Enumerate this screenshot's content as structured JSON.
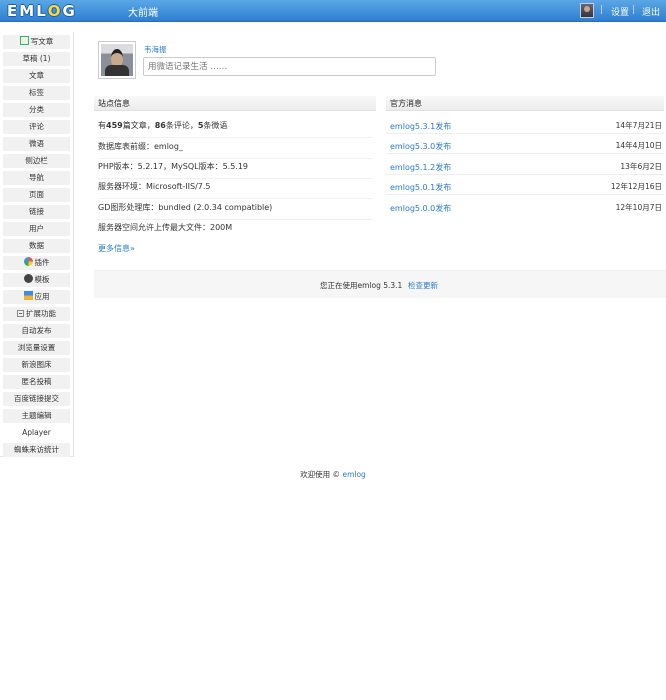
{
  "header": {
    "logo_letters": [
      "E",
      "M",
      "L",
      "O",
      "G"
    ],
    "site_link": "大前端",
    "settings_label": "设置",
    "logout_label": "退出",
    "separator": "|"
  },
  "sidebar": {
    "items": [
      {
        "label": "写文章",
        "icon": "pencil-icon"
      },
      {
        "label": "草稿 (1)"
      },
      {
        "label": "文章"
      },
      {
        "label": "标签"
      },
      {
        "label": "分类"
      },
      {
        "label": "评论"
      },
      {
        "label": "微语"
      },
      {
        "label": "侧边栏"
      },
      {
        "label": "导航"
      },
      {
        "label": "页面"
      },
      {
        "label": "链接"
      },
      {
        "label": "用户"
      },
      {
        "label": "数据"
      },
      {
        "label": "插件",
        "icon": "plugin-icon"
      },
      {
        "label": "模板",
        "icon": "gear-icon"
      },
      {
        "label": "应用",
        "icon": "app-icon"
      },
      {
        "label": "扩展功能",
        "icon": "collapse-icon"
      },
      {
        "label": "自动发布"
      },
      {
        "label": "浏览量设置"
      },
      {
        "label": "新浪图床"
      },
      {
        "label": "匿名投稿"
      },
      {
        "label": "百度链接提交"
      },
      {
        "label": "主题编辑"
      },
      {
        "label": "Aplayer"
      },
      {
        "label": "蜘蛛来访统计"
      }
    ]
  },
  "profile": {
    "username": "韦海振",
    "weibo_placeholder": "用微语记录生活 ……"
  },
  "site_info": {
    "title": "站点信息",
    "stats": {
      "prefix": "有",
      "articles": "459",
      "articles_label": "篇文章，",
      "comments": "86",
      "comments_label": "条评论，",
      "weibo": "5",
      "weibo_label": "条微语"
    },
    "rows": [
      "数据库表前缀：emlog_",
      "PHP版本：5.2.17，MySQL版本：5.5.19",
      "服务器环境：Microsoft-IIS/7.5",
      "GD图形处理库：bundled (2.0.34 compatible)",
      "服务器空间允许上传最大文件：200M"
    ],
    "more_link": "更多信息»"
  },
  "official_news": {
    "title": "官方消息",
    "items": [
      {
        "title": "emlog5.3.1发布",
        "date": "14年7月21日"
      },
      {
        "title": "emlog5.3.0发布",
        "date": "14年4月10日"
      },
      {
        "title": "emlog5.1.2发布",
        "date": "13年6月2日"
      },
      {
        "title": "emlog5.0.1发布",
        "date": "12年12月16日"
      },
      {
        "title": "emlog5.0.0发布",
        "date": "12年10月7日"
      }
    ]
  },
  "version_bar": {
    "text": "您正在使用emlog 5.3.1",
    "check_update": "检查更新"
  },
  "footer": {
    "prefix": "欢迎使用 © ",
    "link": "emlog"
  },
  "colors": {
    "header_bg": "#3f8fdb",
    "link": "#2a7ac9",
    "logo_accent": "#ffd83a"
  }
}
